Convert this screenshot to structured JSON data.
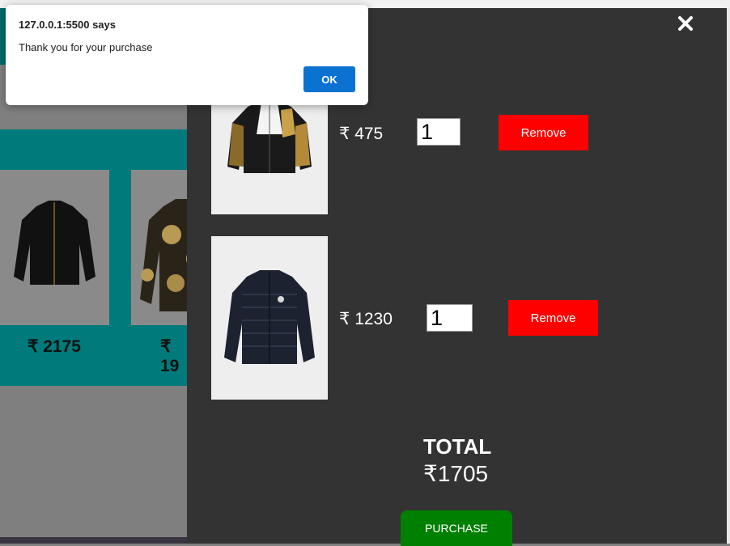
{
  "dialog": {
    "title": "127.0.0.1:5500 says",
    "message": "Thank you for your purchase",
    "ok_label": "OK"
  },
  "background_shop": {
    "products": [
      {
        "price": "₹ 2175"
      },
      {
        "price": "₹ 19"
      }
    ]
  },
  "cart": {
    "items": [
      {
        "price": "₹ 475",
        "quantity": "1",
        "remove_label": "Remove"
      },
      {
        "price": "₹ 1230",
        "quantity": "1",
        "remove_label": "Remove"
      }
    ],
    "total_label": "TOTAL",
    "total_value": "₹1705",
    "purchase_label": "PURCHASE"
  },
  "colors": {
    "panel": "#333333",
    "remove": "#ff0000",
    "purchase": "#008000",
    "teal": "#007a7a",
    "dialog_ok": "#0b72d1"
  },
  "icons": [
    "close-icon",
    "jacket-image"
  ]
}
